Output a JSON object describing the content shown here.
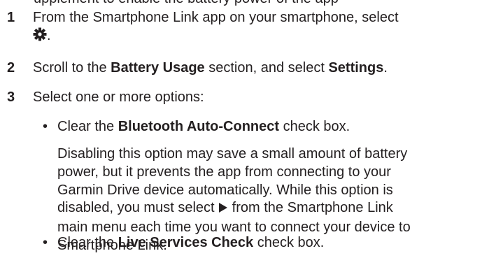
{
  "top_clipped_text": "upplement to enable the battery power of the app",
  "steps": [
    {
      "number": "1",
      "line1": "From the Smartphone Link app on your smartphone, select",
      "line2_end": "."
    },
    {
      "number": "2",
      "pre": "Scroll to the ",
      "bold1": "Battery Usage",
      "mid": " section, and select ",
      "bold2": "Settings",
      "post": "."
    },
    {
      "number": "3",
      "text": "Select one or more options:"
    }
  ],
  "bullets": [
    {
      "dot": "•",
      "pre": "Clear the ",
      "bold": "Bluetooth Auto-Connect",
      "post": " check box."
    },
    {
      "dot": "•",
      "pre": "Clear the ",
      "bold": "Live Services Check",
      "post": " check box."
    }
  ],
  "paragraph": {
    "line1": "Disabling this option may save a small amount of battery",
    "line2": "power, but it prevents the app from connecting to your",
    "line3": "Garmin Drive device automatically. While this option is",
    "line4_pre": "disabled, you must select",
    "line4_post": " from the Smartphone Link",
    "line5": "main menu each time you want to connect your device to",
    "line6": "Smartphone Link."
  },
  "icons": {
    "settings": "gear-icon",
    "play": "play-icon"
  }
}
